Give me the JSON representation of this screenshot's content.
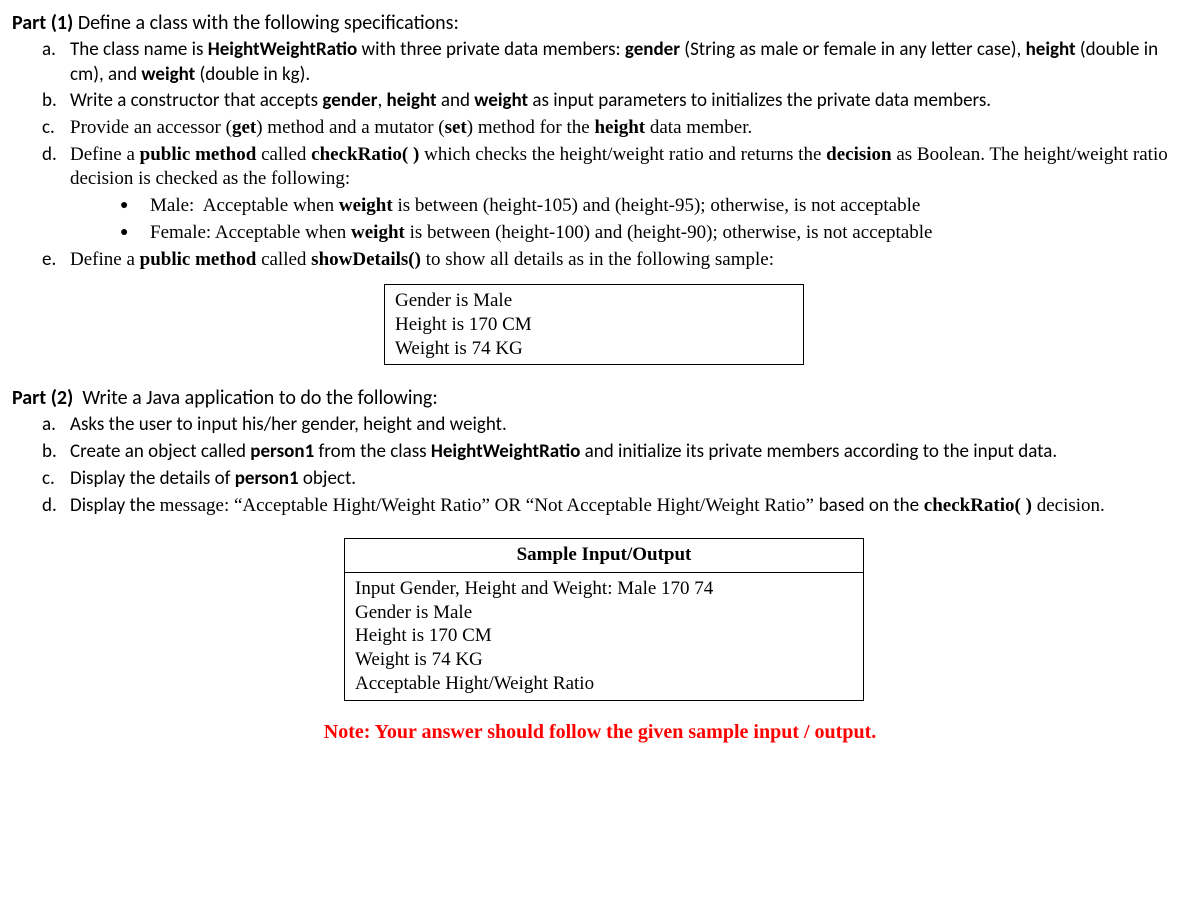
{
  "part1": {
    "header_label": "Part (1)",
    "header_text": "Define a class with the following specifications:",
    "items": {
      "a_marker": "a.",
      "a_html": "The class name is <b>HeightWeightRatio</b> with three private data members: <b>gender</b> (String as male or female in any letter case), <b>height</b> (double in cm), and <b>weight</b> (double in kg).",
      "b_marker": "b.",
      "b_html": "Write a constructor that accepts <b>gender</b>, <b>height</b> and <b>weight</b> as input parameters to initializes the private data members.",
      "c_marker": "c.",
      "c_html": "Provide an accessor (<b>get</b>) method and a mutator (<b>set</b>) method for the <b>height</b> data member.",
      "d_marker": "d.",
      "d_html": "Define a <b>public method</b> called <b>checkRatio( )</b> which checks the height/weight ratio and returns the <b>decision</b> as Boolean. The height/weight ratio decision is checked as the following:",
      "d_sub1_html": "Male:&nbsp; Acceptable when <b>weight</b> is between (height-105) and (height-95); otherwise, is not acceptable",
      "d_sub2_html": "Female: Acceptable when <b>weight</b> is between (height-100) and (height-90); otherwise, is not acceptable",
      "e_marker": "e.",
      "e_html": "Define a <b>public method</b> called <b>showDetails()</b> to show all details as in the following sample:"
    },
    "details_box": {
      "line1": "Gender is Male",
      "line2": "Height is 170 CM",
      "line3": "Weight is 74 KG"
    }
  },
  "part2": {
    "header_label": "Part (2)",
    "header_text": "Write a Java application to do the following:",
    "items": {
      "a_marker": "a.",
      "a_html": "Asks the user to input his/her gender, height and weight.",
      "b_marker": "b.",
      "b_html": "Create an object called <b>person1</b> from the class <b>HeightWeightRatio</b> and initialize its private members according to the input data.",
      "c_marker": "c.",
      "c_html": "Display the details of <b>person1</b> object.",
      "d_marker": "d.",
      "d_html": "<span class='sans'>Display the </span>message: “Acceptable Hight/Weight Ratio” OR “Not Acceptable Hight/Weight Ratio” <span class='sans'>based on the</span> <b>checkRatio( )</b> decision."
    },
    "sample": {
      "header": "Sample Input/Output",
      "lines": {
        "l1": "Input Gender, Height and Weight: Male 170 74",
        "l2": "Gender is Male",
        "l3": "Height is 170 CM",
        "l4": "Weight is 74 KG",
        "l5": "Acceptable Hight/Weight Ratio"
      }
    }
  },
  "note": "Note: Your answer should follow the given sample input / output."
}
